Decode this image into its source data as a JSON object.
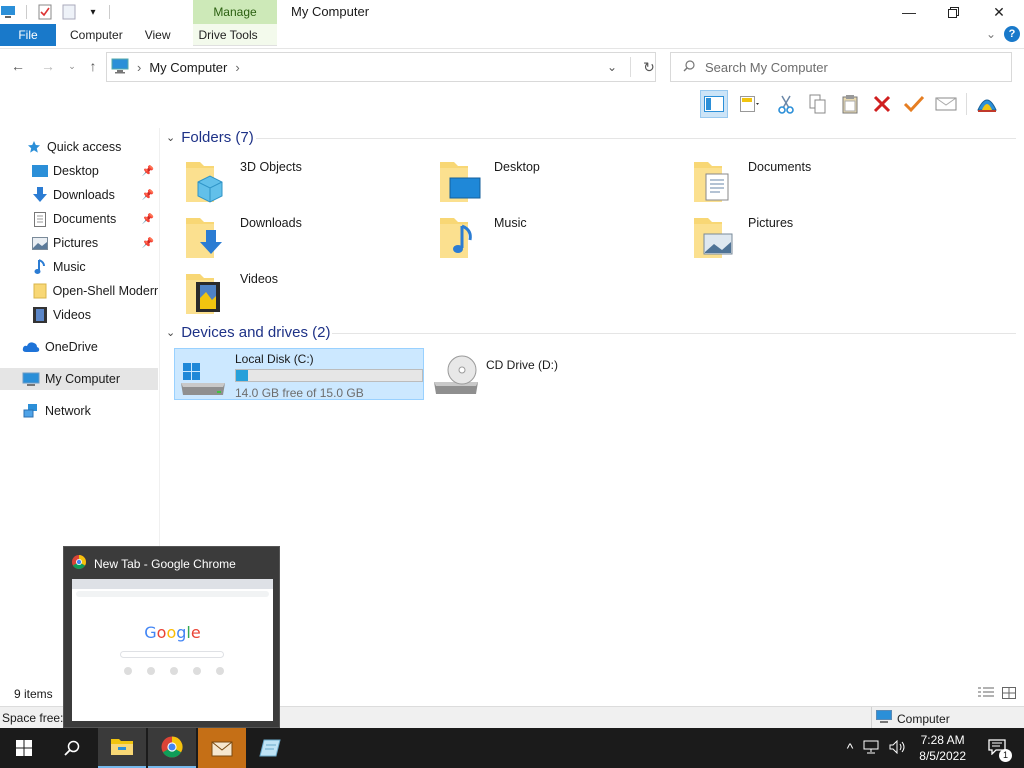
{
  "window": {
    "title": "My Computer",
    "contextual_tab": "Manage"
  },
  "ribbon_tabs": [
    "File",
    "Computer",
    "View",
    "Drive Tools"
  ],
  "address": {
    "path": "My Computer",
    "search_placeholder": "Search My Computer"
  },
  "sidebar": {
    "items": [
      {
        "label": "Quick access",
        "icon": "star-icon"
      },
      {
        "label": "Desktop",
        "icon": "desktop-icon",
        "pinned": true
      },
      {
        "label": "Downloads",
        "icon": "download-icon",
        "pinned": true
      },
      {
        "label": "Documents",
        "icon": "document-icon",
        "pinned": true
      },
      {
        "label": "Pictures",
        "icon": "pictures-icon",
        "pinned": true
      },
      {
        "label": "Music",
        "icon": "music-icon"
      },
      {
        "label": "Open-Shell Modern",
        "icon": "folder-icon"
      },
      {
        "label": "Videos",
        "icon": "video-icon"
      },
      {
        "label": "OneDrive",
        "icon": "cloud-icon"
      },
      {
        "label": "My Computer",
        "icon": "computer-icon",
        "selected": true
      },
      {
        "label": "Network",
        "icon": "network-icon"
      }
    ]
  },
  "folders": {
    "header": "Folders (7)",
    "items": [
      "3D Objects",
      "Desktop",
      "Documents",
      "Downloads",
      "Music",
      "Pictures",
      "Videos"
    ]
  },
  "drives": {
    "header": "Devices and drives (2)",
    "items": [
      {
        "name": "Local Disk (C:)",
        "free": "14.0 GB free of 15.0 GB",
        "used_fraction": 0.067,
        "selected": true
      },
      {
        "name": "CD Drive (D:)"
      }
    ]
  },
  "status": {
    "item_count": "9 items",
    "space_free": "Space free:",
    "location": "Computer"
  },
  "preview": {
    "title": "New Tab - Google Chrome",
    "logo": "Google"
  },
  "clock": {
    "time": "7:28 AM",
    "date": "8/5/2022"
  },
  "notifications": {
    "count": "1"
  },
  "colors": {
    "accent": "#1979ca",
    "manage_tab": "#cde9b8",
    "selection": "#cce8ff",
    "progress": "#26a0da"
  }
}
